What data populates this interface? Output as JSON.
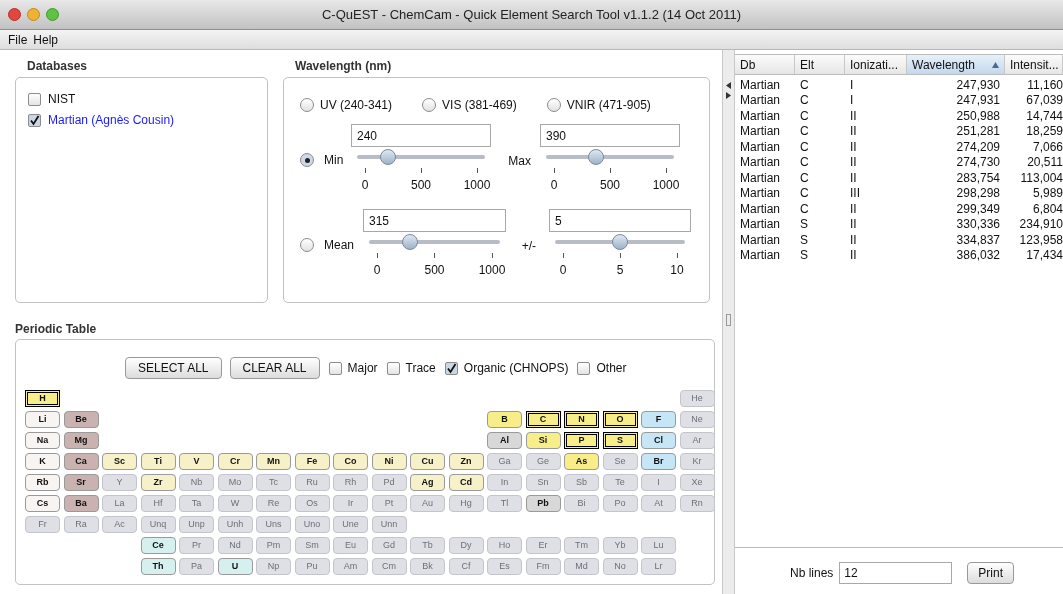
{
  "window": {
    "title": "C-QuEST - ChemCam - Quick Element Search Tool v1.1.2 (14 Oct 2011)"
  },
  "menu": [
    "File",
    "Help"
  ],
  "databases": {
    "title": "Databases",
    "items": [
      {
        "label": "NIST",
        "checked": false
      },
      {
        "label": "Martian (Agnès Cousin)",
        "checked": true
      }
    ]
  },
  "wavelength": {
    "title": "Wavelength (nm)",
    "presets": [
      {
        "label": "UV (240-341)",
        "selected": false
      },
      {
        "label": "VIS (381-469)",
        "selected": false
      },
      {
        "label": "VNIR (471-905)",
        "selected": false
      }
    ],
    "modes": [
      {
        "selected": true,
        "sliders": [
          {
            "label": "Min",
            "value": "240",
            "level": 0.24,
            "ticks": [
              "0",
              "500",
              "1000"
            ]
          },
          {
            "label": "Max",
            "value": "390",
            "level": 0.39,
            "ticks": [
              "0",
              "500",
              "1000"
            ]
          }
        ]
      },
      {
        "selected": false,
        "sliders": [
          {
            "label": "Mean",
            "value": "315",
            "level": 0.315,
            "ticks": [
              "0",
              "500",
              "1000"
            ]
          },
          {
            "label": "+/-",
            "value": "5",
            "level": 0.5,
            "ticks": [
              "0",
              "5",
              "10"
            ]
          }
        ]
      }
    ]
  },
  "periodic_table": {
    "title": "Periodic Table",
    "buttons": [
      "SELECT ALL",
      "CLEAR ALL"
    ],
    "filters": [
      {
        "label": "Major",
        "checked": false
      },
      {
        "label": "Trace",
        "checked": false
      },
      {
        "label": "Organic (CHNOPS)",
        "checked": true
      },
      {
        "label": "Other",
        "checked": false
      }
    ],
    "rows": [
      [
        {
          "symbol": "H",
          "color": "#f7ee8a",
          "enabled": true,
          "selected": true
        },
        null,
        null,
        null,
        null,
        null,
        null,
        null,
        null,
        null,
        null,
        null,
        null,
        null,
        null,
        null,
        null,
        {
          "symbol": "He",
          "color": "#dfe0e6",
          "enabled": false,
          "selected": false
        }
      ],
      [
        {
          "symbol": "Li",
          "color": "#f8f4f2",
          "enabled": true,
          "selected": false
        },
        {
          "symbol": "Be",
          "color": "#c9b2b0",
          "enabled": true,
          "selected": false
        },
        null,
        null,
        null,
        null,
        null,
        null,
        null,
        null,
        null,
        null,
        {
          "symbol": "B",
          "color": "#f7ee8a",
          "enabled": true,
          "selected": false
        },
        {
          "symbol": "C",
          "color": "#f7ee8a",
          "enabled": true,
          "selected": true
        },
        {
          "symbol": "N",
          "color": "#f7ee8a",
          "enabled": true,
          "selected": true
        },
        {
          "symbol": "O",
          "color": "#f7ee8a",
          "enabled": true,
          "selected": true
        },
        {
          "symbol": "F",
          "color": "#c6e6f5",
          "enabled": true,
          "selected": false
        },
        {
          "symbol": "Ne",
          "color": "#dfe0e6",
          "enabled": false,
          "selected": false
        }
      ],
      [
        {
          "symbol": "Na",
          "color": "#f8f4f2",
          "enabled": true,
          "selected": false
        },
        {
          "symbol": "Mg",
          "color": "#c9b2b0",
          "enabled": true,
          "selected": false
        },
        null,
        null,
        null,
        null,
        null,
        null,
        null,
        null,
        null,
        null,
        {
          "symbol": "Al",
          "color": "#d8d8d8",
          "enabled": true,
          "selected": false
        },
        {
          "symbol": "Si",
          "color": "#f7ee8a",
          "enabled": true,
          "selected": false
        },
        {
          "symbol": "P",
          "color": "#f7ee8a",
          "enabled": true,
          "selected": true
        },
        {
          "symbol": "S",
          "color": "#f7ee8a",
          "enabled": true,
          "selected": true
        },
        {
          "symbol": "Cl",
          "color": "#c6e6f5",
          "enabled": true,
          "selected": false
        },
        {
          "symbol": "Ar",
          "color": "#dfe0e6",
          "enabled": false,
          "selected": false
        }
      ],
      [
        {
          "symbol": "K",
          "color": "#f8f4f2",
          "enabled": true,
          "selected": false
        },
        {
          "symbol": "Ca",
          "color": "#c9b2b0",
          "enabled": true,
          "selected": false
        },
        {
          "symbol": "Sc",
          "color": "#f6f1c8",
          "enabled": true,
          "selected": false
        },
        {
          "symbol": "Ti",
          "color": "#f6f1c8",
          "enabled": true,
          "selected": false
        },
        {
          "symbol": "V",
          "color": "#f6f1c8",
          "enabled": true,
          "selected": false
        },
        {
          "symbol": "Cr",
          "color": "#f6f1c8",
          "enabled": true,
          "selected": false
        },
        {
          "symbol": "Mn",
          "color": "#f6f1c8",
          "enabled": true,
          "selected": false
        },
        {
          "symbol": "Fe",
          "color": "#f6f1c8",
          "enabled": true,
          "selected": false
        },
        {
          "symbol": "Co",
          "color": "#f6f1c8",
          "enabled": true,
          "selected": false
        },
        {
          "symbol": "Ni",
          "color": "#f6f1c8",
          "enabled": true,
          "selected": false
        },
        {
          "symbol": "Cu",
          "color": "#f6f1c8",
          "enabled": true,
          "selected": false
        },
        {
          "symbol": "Zn",
          "color": "#f6f1c8",
          "enabled": true,
          "selected": false
        },
        {
          "symbol": "Ga",
          "color": "#dfe0e6",
          "enabled": false,
          "selected": false
        },
        {
          "symbol": "Ge",
          "color": "#dfe0e6",
          "enabled": false,
          "selected": false
        },
        {
          "symbol": "As",
          "color": "#f7ee8a",
          "enabled": true,
          "selected": false
        },
        {
          "symbol": "Se",
          "color": "#dfe0e6",
          "enabled": false,
          "selected": false
        },
        {
          "symbol": "Br",
          "color": "#c6e6f5",
          "enabled": true,
          "selected": false
        },
        {
          "symbol": "Kr",
          "color": "#dfe0e6",
          "enabled": false,
          "selected": false
        }
      ],
      [
        {
          "symbol": "Rb",
          "color": "#f8f4f2",
          "enabled": true,
          "selected": false
        },
        {
          "symbol": "Sr",
          "color": "#c9b2b0",
          "enabled": true,
          "selected": false
        },
        {
          "symbol": "Y",
          "color": "#dfe0e6",
          "enabled": false,
          "selected": false
        },
        {
          "symbol": "Zr",
          "color": "#f6f1c8",
          "enabled": true,
          "selected": false
        },
        {
          "symbol": "Nb",
          "color": "#dfe0e6",
          "enabled": false,
          "selected": false
        },
        {
          "symbol": "Mo",
          "color": "#dfe0e6",
          "enabled": false,
          "selected": false
        },
        {
          "symbol": "Tc",
          "color": "#dfe0e6",
          "enabled": false,
          "selected": false
        },
        {
          "symbol": "Ru",
          "color": "#dfe0e6",
          "enabled": false,
          "selected": false
        },
        {
          "symbol": "Rh",
          "color": "#dfe0e6",
          "enabled": false,
          "selected": false
        },
        {
          "symbol": "Pd",
          "color": "#dfe0e6",
          "enabled": false,
          "selected": false
        },
        {
          "symbol": "Ag",
          "color": "#f6f1c8",
          "enabled": true,
          "selected": false
        },
        {
          "symbol": "Cd",
          "color": "#f6f1c8",
          "enabled": true,
          "selected": false
        },
        {
          "symbol": "In",
          "color": "#dfe0e6",
          "enabled": false,
          "selected": false
        },
        {
          "symbol": "Sn",
          "color": "#dfe0e6",
          "enabled": false,
          "selected": false
        },
        {
          "symbol": "Sb",
          "color": "#dfe0e6",
          "enabled": false,
          "selected": false
        },
        {
          "symbol": "Te",
          "color": "#dfe0e6",
          "enabled": false,
          "selected": false
        },
        {
          "symbol": "I",
          "color": "#dfe0e6",
          "enabled": false,
          "selected": false
        },
        {
          "symbol": "Xe",
          "color": "#dfe0e6",
          "enabled": false,
          "selected": false
        }
      ],
      [
        {
          "symbol": "Cs",
          "color": "#f8f4f2",
          "enabled": true,
          "selected": false
        },
        {
          "symbol": "Ba",
          "color": "#c9b2b0",
          "enabled": true,
          "selected": false
        },
        {
          "symbol": "La",
          "color": "#dfe0e6",
          "enabled": false,
          "selected": false
        },
        {
          "symbol": "Hf",
          "color": "#dfe0e6",
          "enabled": false,
          "selected": false
        },
        {
          "symbol": "Ta",
          "color": "#dfe0e6",
          "enabled": false,
          "selected": false
        },
        {
          "symbol": "W",
          "color": "#dfe0e6",
          "enabled": false,
          "selected": false
        },
        {
          "symbol": "Re",
          "color": "#dfe0e6",
          "enabled": false,
          "selected": false
        },
        {
          "symbol": "Os",
          "color": "#dfe0e6",
          "enabled": false,
          "selected": false
        },
        {
          "symbol": "Ir",
          "color": "#dfe0e6",
          "enabled": false,
          "selected": false
        },
        {
          "symbol": "Pt",
          "color": "#dfe0e6",
          "enabled": false,
          "selected": false
        },
        {
          "symbol": "Au",
          "color": "#dfe0e6",
          "enabled": false,
          "selected": false
        },
        {
          "symbol": "Hg",
          "color": "#dfe0e6",
          "enabled": false,
          "selected": false
        },
        {
          "symbol": "Tl",
          "color": "#dfe0e6",
          "enabled": false,
          "selected": false
        },
        {
          "symbol": "Pb",
          "color": "#d8d8d8",
          "enabled": true,
          "selected": false
        },
        {
          "symbol": "Bi",
          "color": "#dfe0e6",
          "enabled": false,
          "selected": false
        },
        {
          "symbol": "Po",
          "color": "#dfe0e6",
          "enabled": false,
          "selected": false
        },
        {
          "symbol": "At",
          "color": "#dfe0e6",
          "enabled": false,
          "selected": false
        },
        {
          "symbol": "Rn",
          "color": "#dfe0e6",
          "enabled": false,
          "selected": false
        }
      ],
      [
        {
          "symbol": "Fr",
          "color": "#dfe0e6",
          "enabled": false,
          "selected": false
        },
        {
          "symbol": "Ra",
          "color": "#dfe0e6",
          "enabled": false,
          "selected": false
        },
        {
          "symbol": "Ac",
          "color": "#dfe0e6",
          "enabled": false,
          "selected": false
        },
        {
          "symbol": "Unq",
          "color": "#dfe0e6",
          "enabled": false,
          "selected": false
        },
        {
          "symbol": "Unp",
          "color": "#dfe0e6",
          "enabled": false,
          "selected": false
        },
        {
          "symbol": "Unh",
          "color": "#dfe0e6",
          "enabled": false,
          "selected": false
        },
        {
          "symbol": "Uns",
          "color": "#dfe0e6",
          "enabled": false,
          "selected": false
        },
        {
          "symbol": "Uno",
          "color": "#dfe0e6",
          "enabled": false,
          "selected": false
        },
        {
          "symbol": "Une",
          "color": "#dfe0e6",
          "enabled": false,
          "selected": false
        },
        {
          "symbol": "Unn",
          "color": "#dfe0e6",
          "enabled": false,
          "selected": false
        }
      ],
      [
        null,
        null,
        null,
        {
          "symbol": "Ce",
          "color": "#d6f0ef",
          "enabled": true,
          "selected": false
        },
        {
          "symbol": "Pr",
          "color": "#dfe0e6",
          "enabled": false,
          "selected": false
        },
        {
          "symbol": "Nd",
          "color": "#dfe0e6",
          "enabled": false,
          "selected": false
        },
        {
          "symbol": "Pm",
          "color": "#dfe0e6",
          "enabled": false,
          "selected": false
        },
        {
          "symbol": "Sm",
          "color": "#dfe0e6",
          "enabled": false,
          "selected": false
        },
        {
          "symbol": "Eu",
          "color": "#dfe0e6",
          "enabled": false,
          "selected": false
        },
        {
          "symbol": "Gd",
          "color": "#dfe0e6",
          "enabled": false,
          "selected": false
        },
        {
          "symbol": "Tb",
          "color": "#dfe0e6",
          "enabled": false,
          "selected": false
        },
        {
          "symbol": "Dy",
          "color": "#dfe0e6",
          "enabled": false,
          "selected": false
        },
        {
          "symbol": "Ho",
          "color": "#dfe0e6",
          "enabled": false,
          "selected": false
        },
        {
          "symbol": "Er",
          "color": "#dfe0e6",
          "enabled": false,
          "selected": false
        },
        {
          "symbol": "Tm",
          "color": "#dfe0e6",
          "enabled": false,
          "selected": false
        },
        {
          "symbol": "Yb",
          "color": "#dfe0e6",
          "enabled": false,
          "selected": false
        },
        {
          "symbol": "Lu",
          "color": "#dfe0e6",
          "enabled": false,
          "selected": false
        }
      ],
      [
        null,
        null,
        null,
        {
          "symbol": "Th",
          "color": "#d6f0ef",
          "enabled": true,
          "selected": false
        },
        {
          "symbol": "Pa",
          "color": "#dfe0e6",
          "enabled": false,
          "selected": false
        },
        {
          "symbol": "U",
          "color": "#d6f0ef",
          "enabled": true,
          "selected": false
        },
        {
          "symbol": "Np",
          "color": "#dfe0e6",
          "enabled": false,
          "selected": false
        },
        {
          "symbol": "Pu",
          "color": "#dfe0e6",
          "enabled": false,
          "selected": false
        },
        {
          "symbol": "Am",
          "color": "#dfe0e6",
          "enabled": false,
          "selected": false
        },
        {
          "symbol": "Cm",
          "color": "#dfe0e6",
          "enabled": false,
          "selected": false
        },
        {
          "symbol": "Bk",
          "color": "#dfe0e6",
          "enabled": false,
          "selected": false
        },
        {
          "symbol": "Cf",
          "color": "#dfe0e6",
          "enabled": false,
          "selected": false
        },
        {
          "symbol": "Es",
          "color": "#dfe0e6",
          "enabled": false,
          "selected": false
        },
        {
          "symbol": "Fm",
          "color": "#dfe0e6",
          "enabled": false,
          "selected": false
        },
        {
          "symbol": "Md",
          "color": "#dfe0e6",
          "enabled": false,
          "selected": false
        },
        {
          "symbol": "No",
          "color": "#dfe0e6",
          "enabled": false,
          "selected": false
        },
        {
          "symbol": "Lr",
          "color": "#dfe0e6",
          "enabled": false,
          "selected": false
        }
      ]
    ]
  },
  "results": {
    "columns": [
      {
        "label": "Db",
        "sorted": false
      },
      {
        "label": "Elt",
        "sorted": false
      },
      {
        "label": "Ionizati...",
        "sorted": false
      },
      {
        "label": "Wavelength",
        "sorted": true
      },
      {
        "label": "Intensit...",
        "sorted": false
      }
    ],
    "rows": [
      [
        "Martian",
        "C",
        "I",
        "247,930",
        "11,160"
      ],
      [
        "Martian",
        "C",
        "I",
        "247,931",
        "67,039"
      ],
      [
        "Martian",
        "C",
        "II",
        "250,988",
        "14,744"
      ],
      [
        "Martian",
        "C",
        "II",
        "251,281",
        "18,259"
      ],
      [
        "Martian",
        "C",
        "II",
        "274,209",
        "7,066"
      ],
      [
        "Martian",
        "C",
        "II",
        "274,730",
        "20,511"
      ],
      [
        "Martian",
        "C",
        "II",
        "283,754",
        "113,004"
      ],
      [
        "Martian",
        "C",
        "III",
        "298,298",
        "5,989"
      ],
      [
        "Martian",
        "C",
        "II",
        "299,349",
        "6,804"
      ],
      [
        "Martian",
        "S",
        "II",
        "330,336",
        "234,910"
      ],
      [
        "Martian",
        "S",
        "II",
        "334,837",
        "123,958"
      ],
      [
        "Martian",
        "S",
        "II",
        "386,032",
        "17,434"
      ]
    ],
    "nb_lines": {
      "label": "Nb lines",
      "value": "12"
    },
    "print_button": "Print"
  }
}
